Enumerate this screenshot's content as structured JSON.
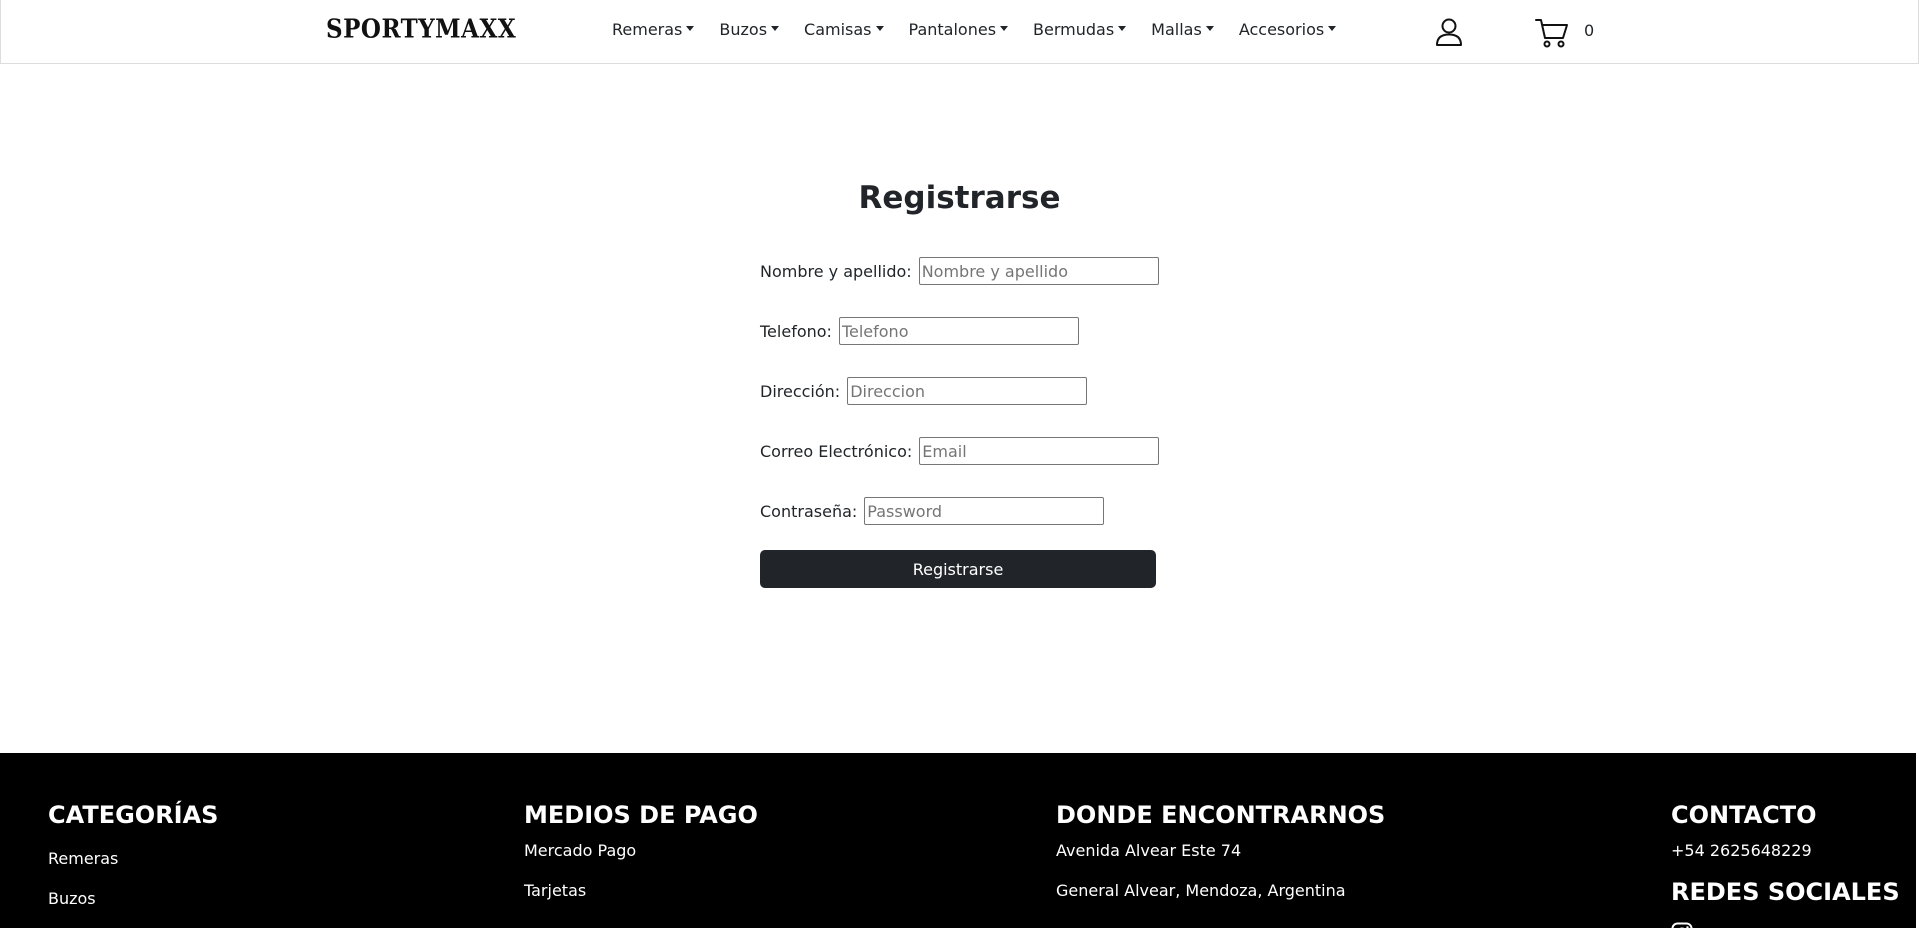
{
  "header": {
    "logo": "SPORTYMAXX",
    "nav": [
      "Remeras",
      "Buzos",
      "Camisas",
      "Pantalones",
      "Bermudas",
      "Mallas",
      "Accesorios"
    ],
    "cart_count": "0"
  },
  "form": {
    "title": "Registrarse",
    "fields": [
      {
        "label": "Nombre y apellido:",
        "placeholder": "Nombre y apellido"
      },
      {
        "label": "Telefono:",
        "placeholder": "Telefono"
      },
      {
        "label": "Dirección:",
        "placeholder": "Direccion"
      },
      {
        "label": "Correo Electrónico:",
        "placeholder": "Email"
      },
      {
        "label": "Contraseña:",
        "placeholder": "Password"
      }
    ],
    "submit_label": "Registrarse"
  },
  "footer": {
    "categories": {
      "heading": "CATEGORÍAS",
      "items": [
        "Remeras",
        "Buzos"
      ]
    },
    "payment": {
      "heading": "MEDIOS DE PAGO",
      "items": [
        "Mercado Pago",
        "Tarjetas"
      ]
    },
    "location": {
      "heading": "DONDE ENCONTRARNOS",
      "items": [
        "Avenida Alvear Este 74",
        "General Alvear, Mendoza, Argentina"
      ]
    },
    "contact": {
      "heading": "CONTACTO",
      "phone": "+54 2625648229"
    },
    "social": {
      "heading": "REDES SOCIALES"
    }
  }
}
